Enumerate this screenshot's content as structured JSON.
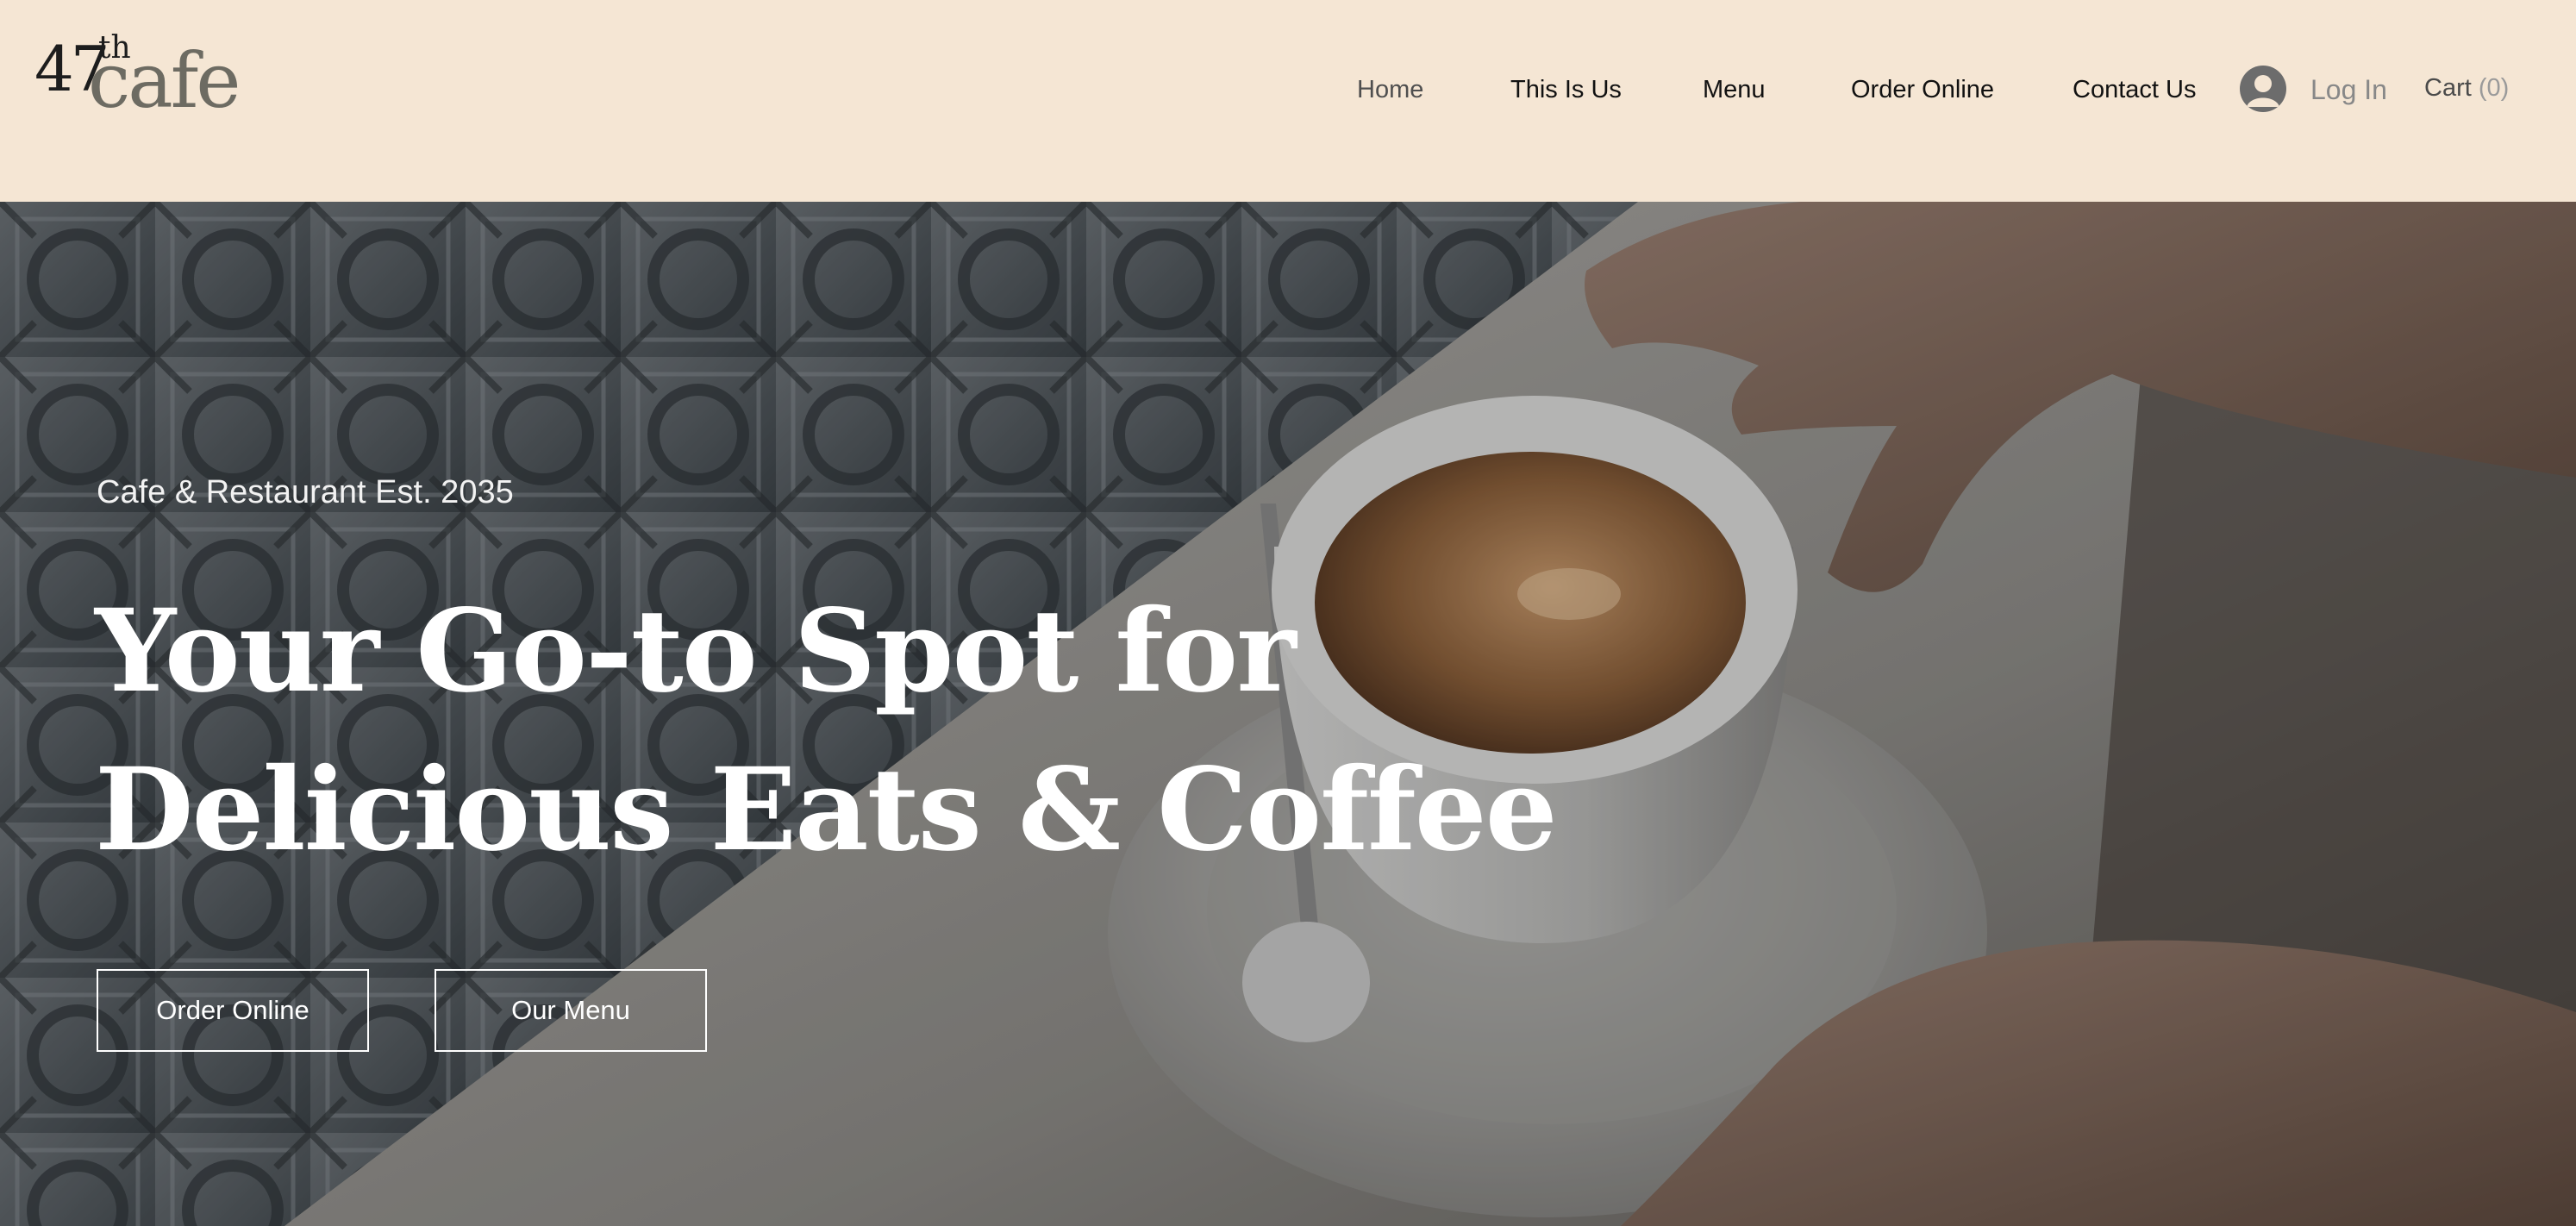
{
  "logo": {
    "number": "47",
    "suffix": "th",
    "word": "cafe"
  },
  "nav": {
    "items": [
      {
        "label": "Home",
        "active": true
      },
      {
        "label": "This Is Us",
        "active": false
      },
      {
        "label": "Menu",
        "active": false
      },
      {
        "label": "Order Online",
        "active": false
      },
      {
        "label": "Contact Us",
        "active": false
      }
    ],
    "login_label": "Log In",
    "cart_label": "Cart",
    "cart_count": "(0)"
  },
  "hero": {
    "tagline": "Cafe & Restaurant Est. 2035",
    "title_line1": "Your Go-to Spot for",
    "title_line2": "Delicious Eats & Coffee",
    "primary_button": "Order Online",
    "secondary_button": "Our Menu"
  },
  "colors": {
    "header_background": "#f5e6d4",
    "hero_text": "#ffffff",
    "logo_dark": "#1d1d1d",
    "logo_muted": "#6d6b62"
  },
  "icons": {
    "login": "user-avatar-icon",
    "hero_image": "coffee-cup-photo"
  }
}
